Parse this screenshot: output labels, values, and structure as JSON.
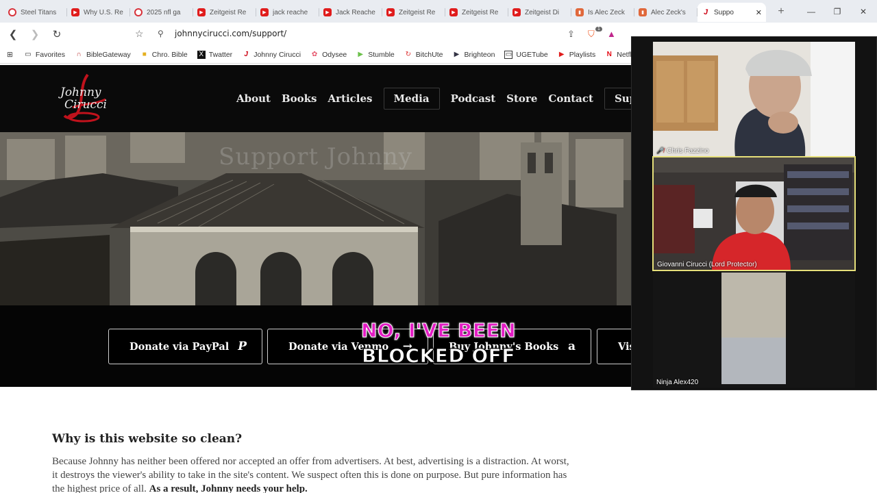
{
  "browser": {
    "tabs": [
      {
        "label": "Steel Titans",
        "icon": "nfl-icon"
      },
      {
        "label": "Why U.S. Re",
        "icon": "youtube-icon"
      },
      {
        "label": "2025 nfl ga",
        "icon": "nfl-icon"
      },
      {
        "label": "Zeitgeist Re",
        "icon": "youtube-icon"
      },
      {
        "label": "jack reache",
        "icon": "youtube-icon"
      },
      {
        "label": "Jack Reache",
        "icon": "youtube-icon"
      },
      {
        "label": "Zeitgeist Re",
        "icon": "youtube-icon"
      },
      {
        "label": "Zeitgeist Re",
        "icon": "youtube-icon"
      },
      {
        "label": "Zeitgeist Di",
        "icon": "youtube-icon"
      },
      {
        "label": "Is Alec Zeck",
        "icon": "bookmark-icon"
      },
      {
        "label": "Alec Zeck's",
        "icon": "bookmark-icon"
      }
    ],
    "active_tab": {
      "label": "Suppo",
      "close": "✕"
    },
    "new_tab": "+",
    "url": "johnnycirucci.com/support/",
    "bookmarks": [
      {
        "label": "Favorites"
      },
      {
        "label": "BibleGateway"
      },
      {
        "label": "Chro. Bible"
      },
      {
        "label": "Twatter"
      },
      {
        "label": "Johnny Cirucci"
      },
      {
        "label": "Odysee"
      },
      {
        "label": "Stumble"
      },
      {
        "label": "BitchUte"
      },
      {
        "label": "Brighteon"
      },
      {
        "label": "UGETube"
      },
      {
        "label": "Playlists"
      },
      {
        "label": "Netflix"
      }
    ],
    "brave_badge": "1"
  },
  "site": {
    "logo_line1": "Johnny",
    "logo_line2": "Cirucci",
    "nav": [
      "About",
      "Books",
      "Articles",
      "Media",
      "Podcast",
      "Store",
      "Contact",
      "Support"
    ],
    "hero_title": "Support Johnny",
    "donate_buttons": [
      {
        "label": "Donate via PayPal",
        "icon": "paypal-icon"
      },
      {
        "label": "Donate via Venmo",
        "icon": "arrow-right-icon"
      },
      {
        "label": "Buy Johnny's Books",
        "icon": "amazon-icon"
      },
      {
        "label": "Vis",
        "icon": ""
      }
    ],
    "article": {
      "heading": "Why is this website so clean?",
      "body": "Because Johnny has neither been offered nor accepted an offer from advertisers. At best, advertising is a distraction. At worst, it destroys the viewer's ability to take in the site's content. We suspect often this is done on purpose. But pure information has the highest price of all.",
      "body_bold": "As a result, Johnny needs your help."
    }
  },
  "caption": {
    "line1": "NO, I'VE BEEN",
    "line2": "BLOCKED OFF",
    "line1_color": "#e31cc4"
  },
  "call": {
    "participants": [
      {
        "name": "Chris Fazzino",
        "muted": true
      },
      {
        "name": "Giovanni Cirucci (Lord Protector)",
        "muted": false,
        "active_speaker": true
      },
      {
        "name": "Ninja Alex420",
        "muted": false
      }
    ],
    "active_border_color": "#e6e07a"
  }
}
